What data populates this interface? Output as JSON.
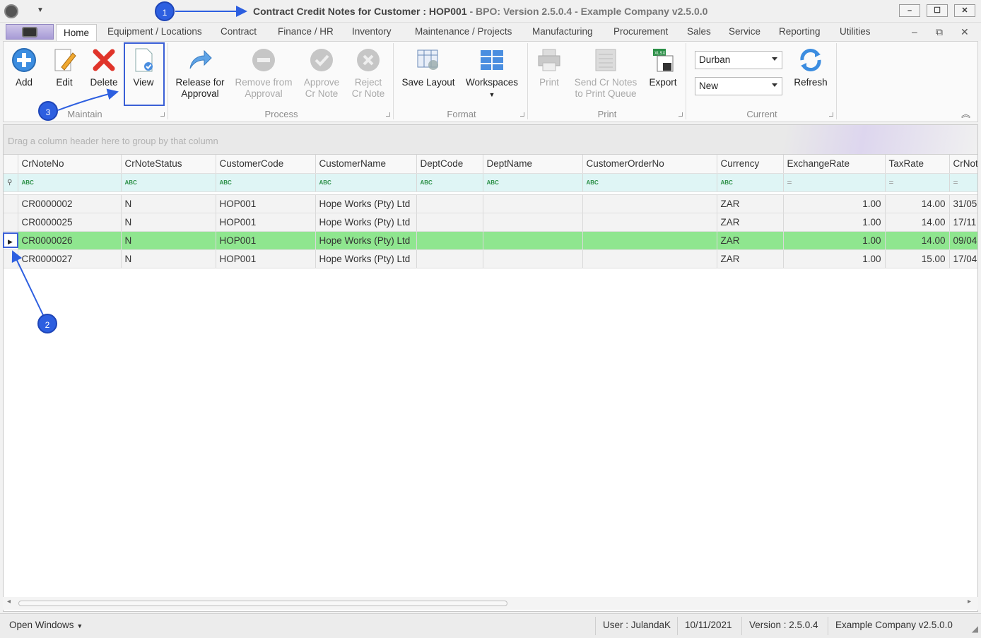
{
  "window": {
    "title_main": "Contract Credit Notes for Customer : HOP001",
    "title_sub": " - BPO: Version 2.5.0.4 - Example Company v2.5.0.0",
    "minimize": "–",
    "maximize": "☐",
    "close": "✕"
  },
  "tabs": [
    "Home",
    "Equipment / Locations",
    "Contract",
    "Finance / HR",
    "Inventory",
    "Maintenance / Projects",
    "Manufacturing",
    "Procurement",
    "Sales",
    "Service",
    "Reporting",
    "Utilities"
  ],
  "ribbon": {
    "maintain": {
      "label": "Maintain",
      "add": "Add",
      "edit": "Edit",
      "delete": "Delete",
      "view": "View"
    },
    "process": {
      "label": "Process",
      "release_1": "Release for",
      "release_2": "Approval",
      "remove_1": "Remove from",
      "remove_2": "Approval",
      "approve_1": "Approve",
      "approve_2": "Cr Note",
      "reject_1": "Reject",
      "reject_2": "Cr Note"
    },
    "format": {
      "label": "Format",
      "save_layout": "Save Layout",
      "workspaces": "Workspaces"
    },
    "print": {
      "label": "Print",
      "print": "Print",
      "send_1": "Send Cr Notes",
      "send_2": "to Print Queue",
      "export": "Export"
    },
    "current": {
      "label": "Current",
      "site": "Durban",
      "status": "New",
      "refresh": "Refresh"
    }
  },
  "grid": {
    "group_hint": "Drag a column header here to group by that column",
    "columns": [
      "CrNoteNo",
      "CrNoteStatus",
      "CustomerCode",
      "CustomerName",
      "DeptCode",
      "DeptName",
      "CustomerOrderNo",
      "Currency",
      "ExchangeRate",
      "TaxRate",
      "CrNot"
    ],
    "rows": [
      [
        "CR0000002",
        "N",
        "HOP001",
        "Hope Works (Pty) Ltd",
        "",
        "",
        "",
        "ZAR",
        "1.00",
        "14.00",
        "31/05"
      ],
      [
        "CR0000025",
        "N",
        "HOP001",
        "Hope Works (Pty) Ltd",
        "",
        "",
        "",
        "ZAR",
        "1.00",
        "14.00",
        "17/11"
      ],
      [
        "CR0000026",
        "N",
        "HOP001",
        "Hope Works (Pty) Ltd",
        "",
        "",
        "",
        "ZAR",
        "1.00",
        "14.00",
        "09/04"
      ],
      [
        "CR0000027",
        "N",
        "HOP001",
        "Hope Works (Pty) Ltd",
        "",
        "",
        "",
        "ZAR",
        "1.00",
        "15.00",
        "17/04"
      ]
    ],
    "selected_row": 2,
    "selected_color": "#8fe68f"
  },
  "status": {
    "open_windows": "Open Windows",
    "user": "User : JulandaK",
    "date": "10/11/2021",
    "version": "Version : 2.5.0.4",
    "company": "Example Company v2.5.0.0"
  },
  "callouts": [
    "1",
    "2",
    "3"
  ],
  "accent": "#2d5fe0"
}
